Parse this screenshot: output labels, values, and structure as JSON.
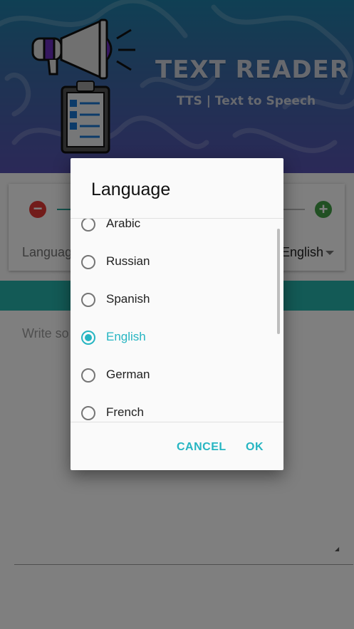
{
  "header": {
    "title": "TEXT READER",
    "subtitle": "TTS | Text to Speech",
    "colors": {
      "gradient_top": "#1f80a8",
      "gradient_bottom": "#5752b0"
    }
  },
  "background": {
    "language_label": "Languag",
    "language_value": "English",
    "text_hint": "Write so"
  },
  "dialog": {
    "title": "Language",
    "options": [
      {
        "label": "Arabic",
        "selected": false
      },
      {
        "label": "Russian",
        "selected": false
      },
      {
        "label": "Spanish",
        "selected": false
      },
      {
        "label": "English",
        "selected": true
      },
      {
        "label": "German",
        "selected": false
      },
      {
        "label": "French",
        "selected": false
      }
    ],
    "cancel_label": "CANCEL",
    "ok_label": "OK",
    "accent": "#26b5c2"
  }
}
